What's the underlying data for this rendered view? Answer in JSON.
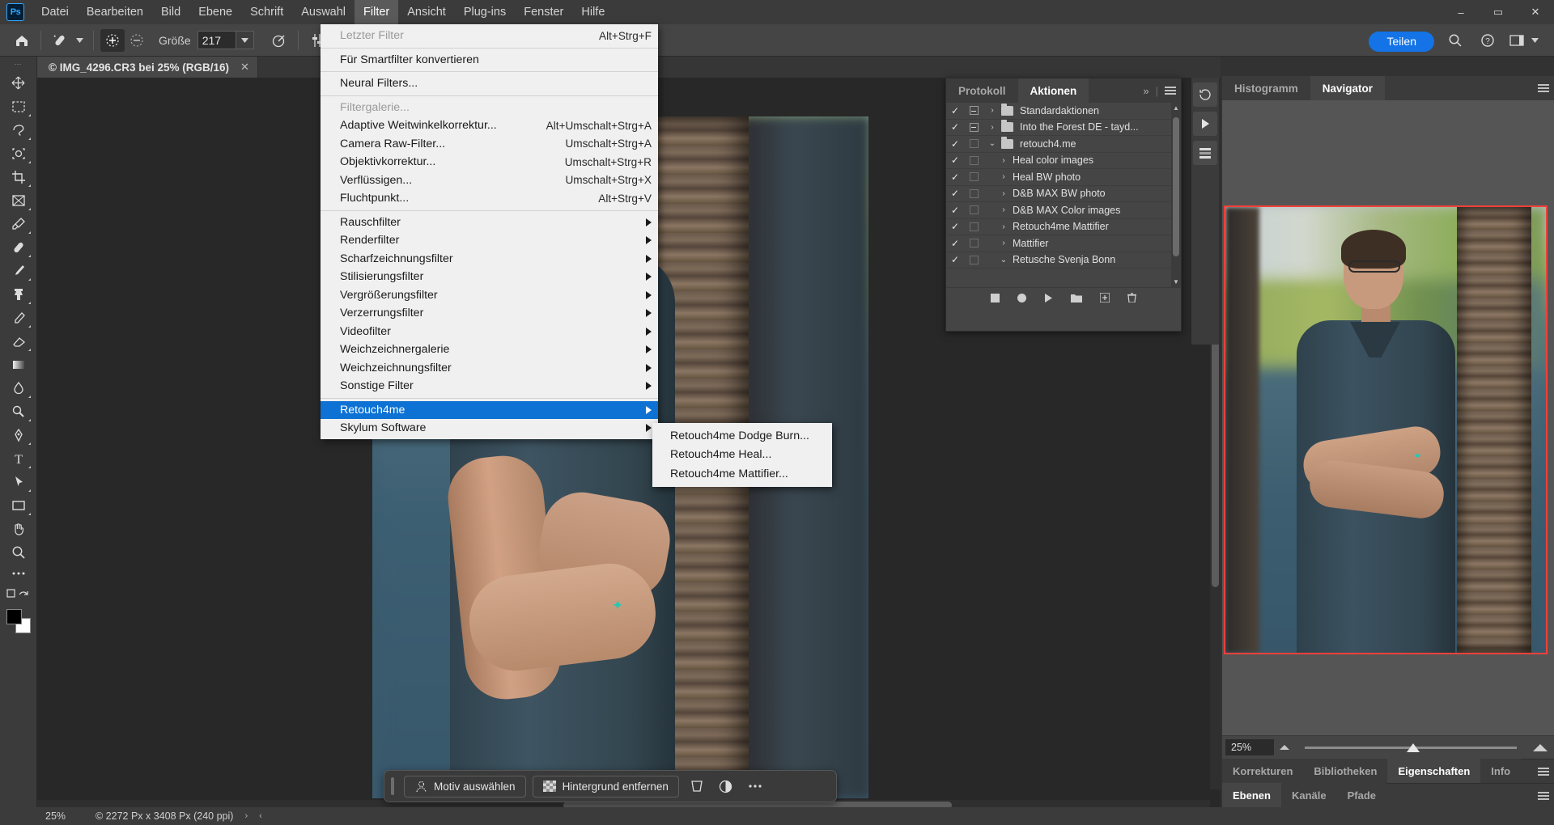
{
  "app": {
    "logo_text": "Ps",
    "window_controls": {
      "minimize": "–",
      "maximize": "▭",
      "close": "✕"
    }
  },
  "menubar": {
    "items": [
      {
        "label": "Datei",
        "active": false
      },
      {
        "label": "Bearbeiten",
        "active": false
      },
      {
        "label": "Bild",
        "active": false
      },
      {
        "label": "Ebene",
        "active": false
      },
      {
        "label": "Schrift",
        "active": false
      },
      {
        "label": "Auswahl",
        "active": false
      },
      {
        "label": "Filter",
        "active": true
      },
      {
        "label": "Ansicht",
        "active": false
      },
      {
        "label": "Plug-ins",
        "active": false
      },
      {
        "label": "Fenster",
        "active": false
      },
      {
        "label": "Hilfe",
        "active": false
      }
    ]
  },
  "options_bar": {
    "home_icon": "home-icon",
    "tool_preset_icon": "healing-brush-icon",
    "add_icon": "add-to-selection-icon",
    "subtract_icon": "subtract-from-selection-icon",
    "size_label": "Größe",
    "size_value": "217",
    "target_icon": "target-icon",
    "share_label": "Teilen",
    "search_icon": "search-icon",
    "help_icon": "help-icon",
    "workspace_icon": "workspace-icon",
    "chevron_icon": "chevron-down-icon"
  },
  "toolbar": {
    "tools": [
      "move-tool",
      "rectangular-marquee-tool",
      "lasso-tool",
      "object-selection-tool",
      "crop-tool",
      "frame-tool",
      "eyedropper-tool",
      "spot-healing-brush-tool",
      "brush-tool",
      "clone-stamp-tool",
      "history-brush-tool",
      "eraser-tool",
      "gradient-tool",
      "blur-tool",
      "dodge-tool",
      "pen-tool",
      "type-tool",
      "path-selection-tool",
      "rectangle-tool",
      "hand-tool",
      "zoom-tool",
      "more-tools",
      "edit-toolbar"
    ],
    "foreground_color": "#000000",
    "background_color": "#ffffff"
  },
  "document": {
    "tab_title": "© IMG_4296.CR3 bei 25% (RGB/16)",
    "close_icon": "close-icon"
  },
  "contextual_bar": {
    "select_subject_label": "Motiv auswählen",
    "select_subject_icon": "subject-icon",
    "remove_background_label": "Hintergrund entfernen",
    "remove_background_icon": "checkerboard-icon",
    "transform_icon": "transform-icon",
    "adjustment_icon": "adjustment-icon",
    "more_icon": "more-options-icon"
  },
  "status_bar": {
    "zoom": "25%",
    "doc_info": "© 2272 Px x 3408 Px (240 ppi)",
    "chevron_right": "›",
    "chevron_left": "‹"
  },
  "filter_menu": {
    "groups": [
      [
        {
          "label": "Letzter Filter",
          "shortcut": "Alt+Strg+F",
          "disabled": true,
          "submenu": false
        }
      ],
      [
        {
          "label": "Für Smartfilter konvertieren",
          "shortcut": "",
          "disabled": false,
          "submenu": false
        }
      ],
      [
        {
          "label": "Neural Filters...",
          "shortcut": "",
          "disabled": false,
          "submenu": false
        }
      ],
      [
        {
          "label": "Filtergalerie...",
          "shortcut": "",
          "disabled": true,
          "submenu": false
        },
        {
          "label": "Adaptive Weitwinkelkorrektur...",
          "shortcut": "Alt+Umschalt+Strg+A",
          "disabled": false,
          "submenu": false
        },
        {
          "label": "Camera Raw-Filter...",
          "shortcut": "Umschalt+Strg+A",
          "disabled": false,
          "submenu": false
        },
        {
          "label": "Objektivkorrektur...",
          "shortcut": "Umschalt+Strg+R",
          "disabled": false,
          "submenu": false
        },
        {
          "label": "Verflüssigen...",
          "shortcut": "Umschalt+Strg+X",
          "disabled": false,
          "submenu": false
        },
        {
          "label": "Fluchtpunkt...",
          "shortcut": "Alt+Strg+V",
          "disabled": false,
          "submenu": false
        }
      ],
      [
        {
          "label": "Rauschfilter",
          "shortcut": "",
          "disabled": false,
          "submenu": true
        },
        {
          "label": "Renderfilter",
          "shortcut": "",
          "disabled": false,
          "submenu": true
        },
        {
          "label": "Scharfzeichnungsfilter",
          "shortcut": "",
          "disabled": false,
          "submenu": true
        },
        {
          "label": "Stilisierungsfilter",
          "shortcut": "",
          "disabled": false,
          "submenu": true
        },
        {
          "label": "Vergrößerungsfilter",
          "shortcut": "",
          "disabled": false,
          "submenu": true
        },
        {
          "label": "Verzerrungsfilter",
          "shortcut": "",
          "disabled": false,
          "submenu": true
        },
        {
          "label": "Videofilter",
          "shortcut": "",
          "disabled": false,
          "submenu": true
        },
        {
          "label": "Weichzeichnergalerie",
          "shortcut": "",
          "disabled": false,
          "submenu": true
        },
        {
          "label": "Weichzeichnungsfilter",
          "shortcut": "",
          "disabled": false,
          "submenu": true
        },
        {
          "label": "Sonstige Filter",
          "shortcut": "",
          "disabled": false,
          "submenu": true
        }
      ],
      [
        {
          "label": "Retouch4me",
          "shortcut": "",
          "disabled": false,
          "submenu": true,
          "highlighted": true
        },
        {
          "label": "Skylum Software",
          "shortcut": "",
          "disabled": false,
          "submenu": true
        }
      ]
    ],
    "highlight_color": "#0d72d4"
  },
  "filter_submenu": {
    "items": [
      {
        "label": "Retouch4me Dodge Burn..."
      },
      {
        "label": "Retouch4me Heal..."
      },
      {
        "label": "Retouch4me Mattifier..."
      }
    ]
  },
  "actions_panel": {
    "tabs": [
      {
        "label": "Protokoll",
        "active": false
      },
      {
        "label": "Aktionen",
        "active": true
      }
    ],
    "expand_icon": "chevron-double-right-icon",
    "menu_icon": "panel-menu-icon",
    "rows": [
      {
        "checked": true,
        "box": "minus",
        "twisty": "›",
        "folder": true,
        "indent": 0,
        "label": "Standardaktionen"
      },
      {
        "checked": true,
        "box": "minus",
        "twisty": "›",
        "folder": true,
        "indent": 0,
        "label": "Into the Forest DE - tayd..."
      },
      {
        "checked": true,
        "box": "empty",
        "twisty": "⌄",
        "folder": true,
        "indent": 0,
        "label": "retouch4.me"
      },
      {
        "checked": true,
        "box": "empty",
        "twisty": "›",
        "folder": false,
        "indent": 1,
        "label": "Heal  color images"
      },
      {
        "checked": true,
        "box": "empty",
        "twisty": "›",
        "folder": false,
        "indent": 1,
        "label": "Heal  BW photo"
      },
      {
        "checked": true,
        "box": "empty",
        "twisty": "›",
        "folder": false,
        "indent": 1,
        "label": "D&B MAX BW photo"
      },
      {
        "checked": true,
        "box": "empty",
        "twisty": "›",
        "folder": false,
        "indent": 1,
        "label": "D&B MAX  Color images"
      },
      {
        "checked": true,
        "box": "empty",
        "twisty": "›",
        "folder": false,
        "indent": 1,
        "label": "Retouch4me Mattifier"
      },
      {
        "checked": true,
        "box": "empty",
        "twisty": "›",
        "folder": false,
        "indent": 1,
        "label": "Mattifier"
      },
      {
        "checked": true,
        "box": "empty",
        "twisty": "⌄",
        "folder": false,
        "indent": 1,
        "label": "Retusche Svenja Bonn"
      }
    ],
    "footer_icons": [
      "stop-icon",
      "record-icon",
      "play-icon",
      "new-set-icon",
      "new-action-icon",
      "delete-icon"
    ],
    "check_glyph": "✓"
  },
  "vertical_strip": {
    "buttons": [
      "history-icon",
      "play-icon",
      "actions-icon"
    ]
  },
  "navigator_panel": {
    "tabs": [
      {
        "label": "Histogramm",
        "active": false
      },
      {
        "label": "Navigator",
        "active": true
      }
    ],
    "menu_icon": "panel-menu-icon",
    "zoom_value": "25%",
    "zoom_out_icon": "zoom-out-icon",
    "zoom_in_icon": "zoom-in-icon",
    "view_box_color": "#f2403a"
  },
  "lower_dock": {
    "row1": [
      {
        "label": "Korrekturen",
        "active": false
      },
      {
        "label": "Bibliotheken",
        "active": false
      },
      {
        "label": "Eigenschaften",
        "active": true
      },
      {
        "label": "Info",
        "active": false
      }
    ],
    "row2": [
      {
        "label": "Ebenen",
        "active": true
      },
      {
        "label": "Kanäle",
        "active": false
      },
      {
        "label": "Pfade",
        "active": false
      }
    ],
    "menu_icon": "panel-menu-icon"
  }
}
